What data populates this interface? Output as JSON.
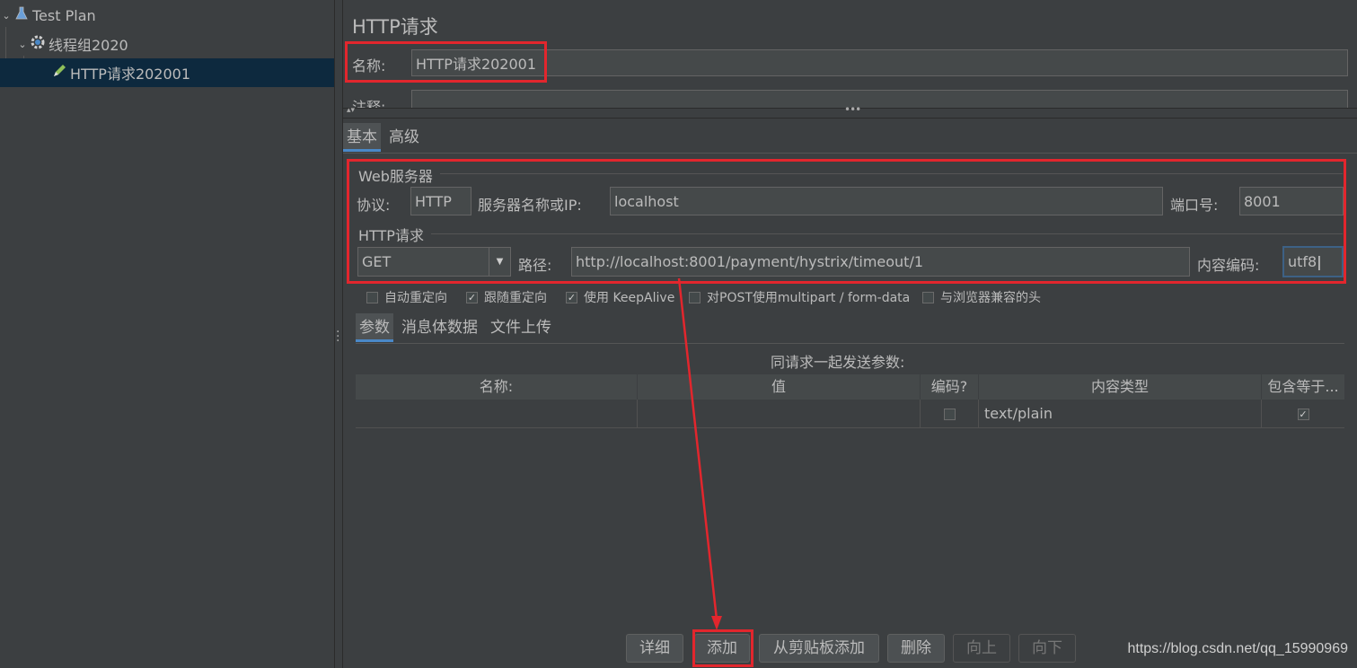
{
  "tree": {
    "items": [
      {
        "label": "Test Plan",
        "icon": "flask-icon"
      },
      {
        "label": "线程组2020",
        "icon": "gear-icon"
      },
      {
        "label": "HTTP请求202001",
        "icon": "pen-icon"
      }
    ]
  },
  "panel": {
    "title": "HTTP请求",
    "name_label": "名称:",
    "name_value": "HTTP请求202001",
    "comment_label": "注释:",
    "tabs": [
      "基本",
      "高级"
    ]
  },
  "web_server": {
    "section_title": "Web服务器",
    "protocol_label": "协议:",
    "protocol_value": "HTTP",
    "server_label": "服务器名称或IP:",
    "server_value": "localhost",
    "port_label": "端口号:",
    "port_value": "8001"
  },
  "http_request": {
    "section_title": "HTTP请求",
    "method": "GET",
    "path_label": "路径:",
    "path_value": "http://localhost:8001/payment/hystrix/timeout/1",
    "encoding_label": "内容编码:",
    "encoding_value": "utf8"
  },
  "options": [
    {
      "label": "自动重定向",
      "checked": false
    },
    {
      "label": "跟随重定向",
      "checked": true
    },
    {
      "label": "使用 KeepAlive",
      "checked": true
    },
    {
      "label": "对POST使用multipart / form-data",
      "checked": false
    },
    {
      "label": "与浏览器兼容的头",
      "checked": false
    }
  ],
  "sub_tabs": [
    "参数",
    "消息体数据",
    "文件上传"
  ],
  "params": {
    "caption": "同请求一起发送参数:",
    "columns": [
      "名称:",
      "值",
      "编码?",
      "内容类型",
      "包含等于..."
    ],
    "rows": [
      {
        "name": "",
        "value": "",
        "encode": false,
        "content_type": "text/plain",
        "include_equals": true
      }
    ]
  },
  "buttons": [
    {
      "label": "详细",
      "enabled": true
    },
    {
      "label": "添加",
      "enabled": true
    },
    {
      "label": "从剪贴板添加",
      "enabled": true
    },
    {
      "label": "删除",
      "enabled": true
    },
    {
      "label": "向上",
      "enabled": false
    },
    {
      "label": "向下",
      "enabled": false
    }
  ],
  "watermark": "https://blog.csdn.net/qq_15990969",
  "colors": {
    "annotation": "#e2262d",
    "accent": "#4a88c7",
    "selection": "#0d293e"
  }
}
